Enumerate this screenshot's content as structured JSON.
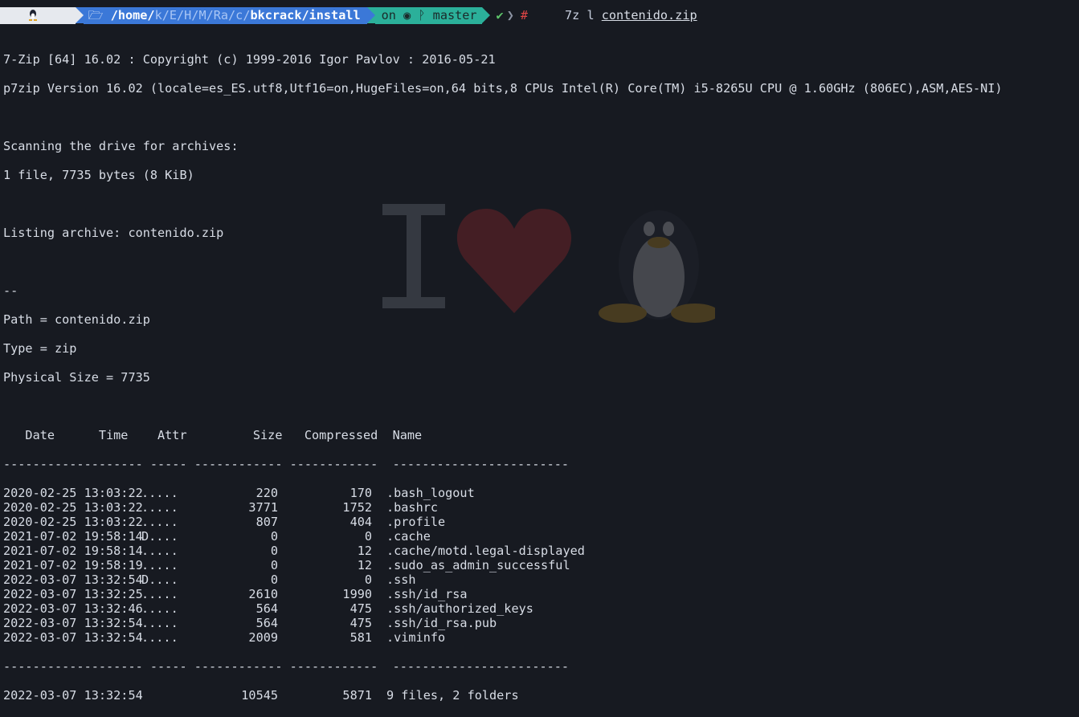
{
  "prompt": {
    "dir_home": "/home/",
    "dir_abbrev": "k/E/H/M/Ra/c/",
    "dir_bold": "bkcrack/install",
    "git_on": "on",
    "git_branch": "master",
    "status_ok": "✔",
    "root_hash": "#",
    "command_bin": "7z l",
    "command_arg": "contenido.zip"
  },
  "output": {
    "header1": "7-Zip [64] 16.02 : Copyright (c) 1999-2016 Igor Pavlov : 2016-05-21",
    "header2": "p7zip Version 16.02 (locale=es_ES.utf8,Utf16=on,HugeFiles=on,64 bits,8 CPUs Intel(R) Core(TM) i5-8265U CPU @ 1.60GHz (806EC),ASM,AES-NI)",
    "scan1": "Scanning the drive for archives:",
    "scan2": "1 file, 7735 bytes (8 KiB)",
    "listing": "Listing archive: contenido.zip",
    "dashes": "--",
    "path": "Path = contenido.zip",
    "type": "Type = zip",
    "physical": "Physical Size = 7735",
    "col_header": "   Date      Time    Attr         Size   Compressed  Name",
    "separator": "------------------- ----- ------------ ------------  ------------------------",
    "rows": [
      {
        "date": "2020-02-25 13:03:22",
        "attr": ".....",
        "size": "220",
        "comp": "170",
        "name": ".bash_logout"
      },
      {
        "date": "2020-02-25 13:03:22",
        "attr": ".....",
        "size": "3771",
        "comp": "1752",
        "name": ".bashrc"
      },
      {
        "date": "2020-02-25 13:03:22",
        "attr": ".....",
        "size": "807",
        "comp": "404",
        "name": ".profile"
      },
      {
        "date": "2021-07-02 19:58:14",
        "attr": "D....",
        "size": "0",
        "comp": "0",
        "name": ".cache"
      },
      {
        "date": "2021-07-02 19:58:14",
        "attr": ".....",
        "size": "0",
        "comp": "12",
        "name": ".cache/motd.legal-displayed"
      },
      {
        "date": "2021-07-02 19:58:19",
        "attr": ".....",
        "size": "0",
        "comp": "12",
        "name": ".sudo_as_admin_successful"
      },
      {
        "date": "2022-03-07 13:32:54",
        "attr": "D....",
        "size": "0",
        "comp": "0",
        "name": ".ssh"
      },
      {
        "date": "2022-03-07 13:32:25",
        "attr": ".....",
        "size": "2610",
        "comp": "1990",
        "name": ".ssh/id_rsa"
      },
      {
        "date": "2022-03-07 13:32:46",
        "attr": ".....",
        "size": "564",
        "comp": "475",
        "name": ".ssh/authorized_keys"
      },
      {
        "date": "2022-03-07 13:32:54",
        "attr": ".....",
        "size": "564",
        "comp": "475",
        "name": ".ssh/id_rsa.pub"
      },
      {
        "date": "2022-03-07 13:32:54",
        "attr": ".....",
        "size": "2009",
        "comp": "581",
        "name": ".viminfo"
      }
    ],
    "total": {
      "date": "2022-03-07 13:32:54",
      "attr": "",
      "size": "10545",
      "comp": "5871",
      "name": "9 files, 2 folders"
    }
  },
  "colors": {
    "background": "#171a21",
    "os_segment": "#e6e9ee",
    "dir_segment": "#3b78d8",
    "git_segment": "#2bb09a",
    "ok": "#5ec46a",
    "root_hash": "#e24545"
  }
}
